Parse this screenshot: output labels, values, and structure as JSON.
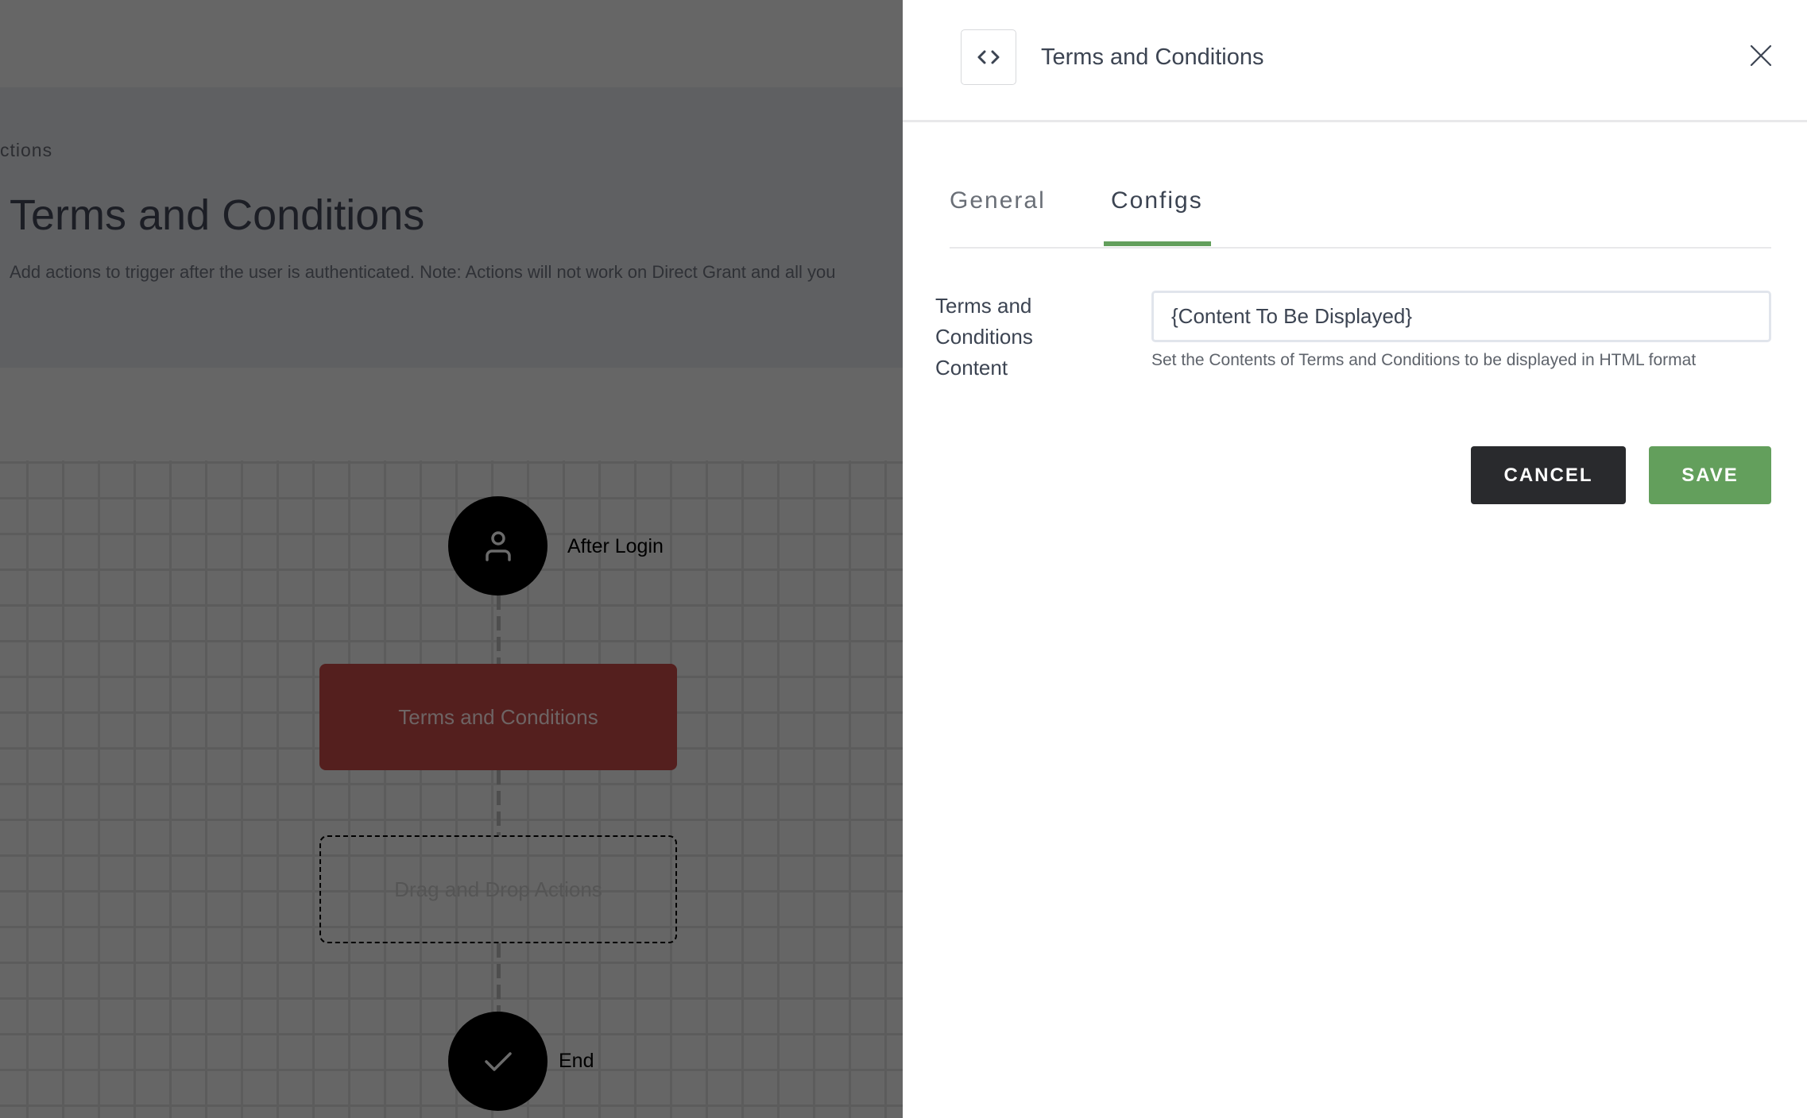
{
  "background": {
    "breadcrumb_fragment": "ctions",
    "page_title": "Terms and Conditions",
    "page_description": "Add actions to trigger after the user is authenticated. Note: Actions will not work on Direct Grant and all you",
    "flow": {
      "start_node": {
        "label": "After Login",
        "icon": "user-icon"
      },
      "action_node": {
        "label": "Terms and Conditions",
        "color": "#541f1e"
      },
      "drop_zone": {
        "label": "Drag and Drop Actions"
      },
      "end_node": {
        "label": "End",
        "icon": "check-icon"
      }
    }
  },
  "panel": {
    "icon": "code-brackets-icon",
    "title": "Terms and Conditions",
    "close_icon": "close-icon",
    "tabs": [
      {
        "label": "General",
        "active": false
      },
      {
        "label": "Configs",
        "active": true
      }
    ],
    "field": {
      "label": "Terms and Conditions Content",
      "value": "{Content To Be Displayed}",
      "hint": "Set the Contents of Terms and Conditions to be displayed in HTML format"
    },
    "buttons": {
      "cancel": "CANCEL",
      "save": "SAVE"
    },
    "colors": {
      "accent": "#639f5c",
      "cancel": "#292a2d"
    }
  }
}
